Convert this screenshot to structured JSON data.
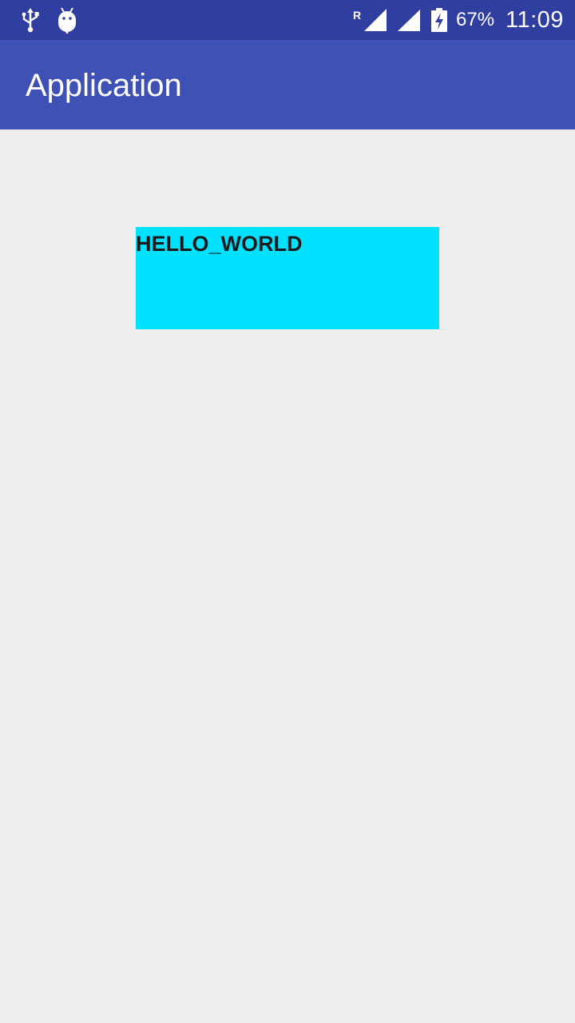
{
  "status_bar": {
    "icons": [
      "usb-icon",
      "android-debug-icon",
      "roaming-signal-icon",
      "signal-icon",
      "battery-charging-icon"
    ],
    "roaming_indicator": "R",
    "battery_percent": "67%",
    "time": "11:09"
  },
  "app_bar": {
    "title": "Application"
  },
  "content": {
    "hello_text": "HELLO_WORLD"
  },
  "colors": {
    "status_bar": "#303f9f",
    "app_bar": "#3f51b5",
    "background": "#eeeeee",
    "hello_box": "#00e0ff"
  }
}
